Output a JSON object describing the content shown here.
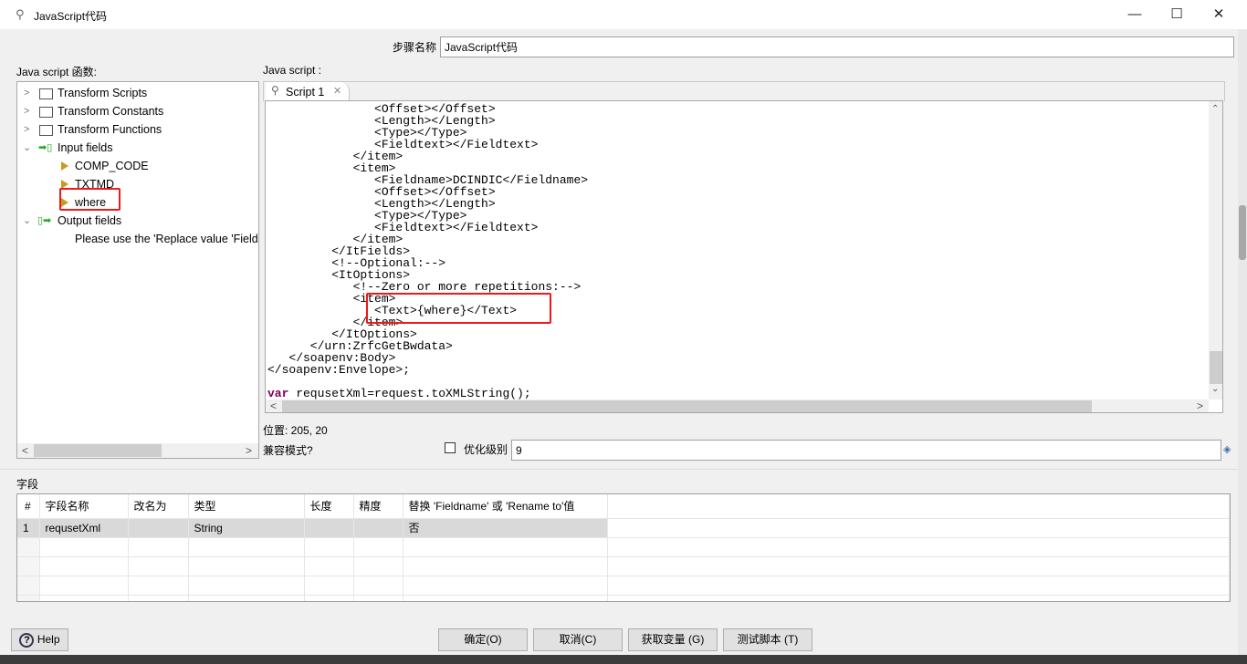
{
  "window": {
    "title": "JavaScript代码",
    "minimize": "—",
    "maximize": "☐",
    "close": "✕"
  },
  "step_name": {
    "label": "步骤名称",
    "value": "JavaScript代码"
  },
  "functions_panel": {
    "label": "Java script 函数:",
    "tree": [
      {
        "label": "Transform Scripts",
        "type": "folder",
        "expanded": false
      },
      {
        "label": "Transform Constants",
        "type": "folder",
        "expanded": false
      },
      {
        "label": "Transform Functions",
        "type": "folder",
        "expanded": false
      },
      {
        "label": "Input fields",
        "type": "input",
        "expanded": true,
        "children": [
          "COMP_CODE",
          "TXTMD",
          "where"
        ]
      },
      {
        "label": "Output fields",
        "type": "output",
        "expanded": true,
        "children": [
          "Please use the 'Replace value 'Fieldname' or 'Rename to'' "
        ]
      }
    ]
  },
  "script_panel": {
    "label": "Java script :",
    "tab": "Script 1",
    "code_lines": [
      "               <Offset></Offset>",
      "               <Length></Length>",
      "               <Type></Type>",
      "               <Fieldtext></Fieldtext>",
      "            </item>",
      "            <item>",
      "               <Fieldname>DCINDIC</Fieldname>",
      "               <Offset></Offset>",
      "               <Length></Length>",
      "               <Type></Type>",
      "               <Fieldtext></Fieldtext>",
      "            </item>",
      "         </ItFields>",
      "         <!--Optional:-->",
      "         <ItOptions>",
      "            <!--Zero or more repetitions:-->",
      "            <item>",
      "               <Text>{where}</Text>",
      "            </item>",
      "         </ItOptions>",
      "      </urn:ZrfcGetBwdata>",
      "   </soapenv:Body>",
      "</soapenv:Envelope>;",
      ""
    ],
    "last_line_keyword": "var",
    "last_line_rest": " requsetXml=request.toXMLString();",
    "keyword_color": "#7f0055"
  },
  "position": "位置: 205, 20",
  "compat_mode": {
    "label": "兼容模式?",
    "checked": false
  },
  "optimization": {
    "label": "优化级别",
    "value": "9"
  },
  "fields": {
    "label": "字段",
    "columns": [
      "#",
      "字段名称",
      "改名为",
      "类型",
      "长度",
      "精度",
      "替换 'Fieldname' 或 'Rename to'值"
    ],
    "rows": [
      [
        "1",
        "requsetXml",
        "",
        "String",
        "",
        "",
        "否"
      ]
    ]
  },
  "buttons": {
    "help": "Help",
    "ok": "确定(O)",
    "cancel": "取消(C)",
    "get_vars": "获取变量 (G)",
    "test": "测试脚本 (T)"
  },
  "highlight_color": "#f01818"
}
